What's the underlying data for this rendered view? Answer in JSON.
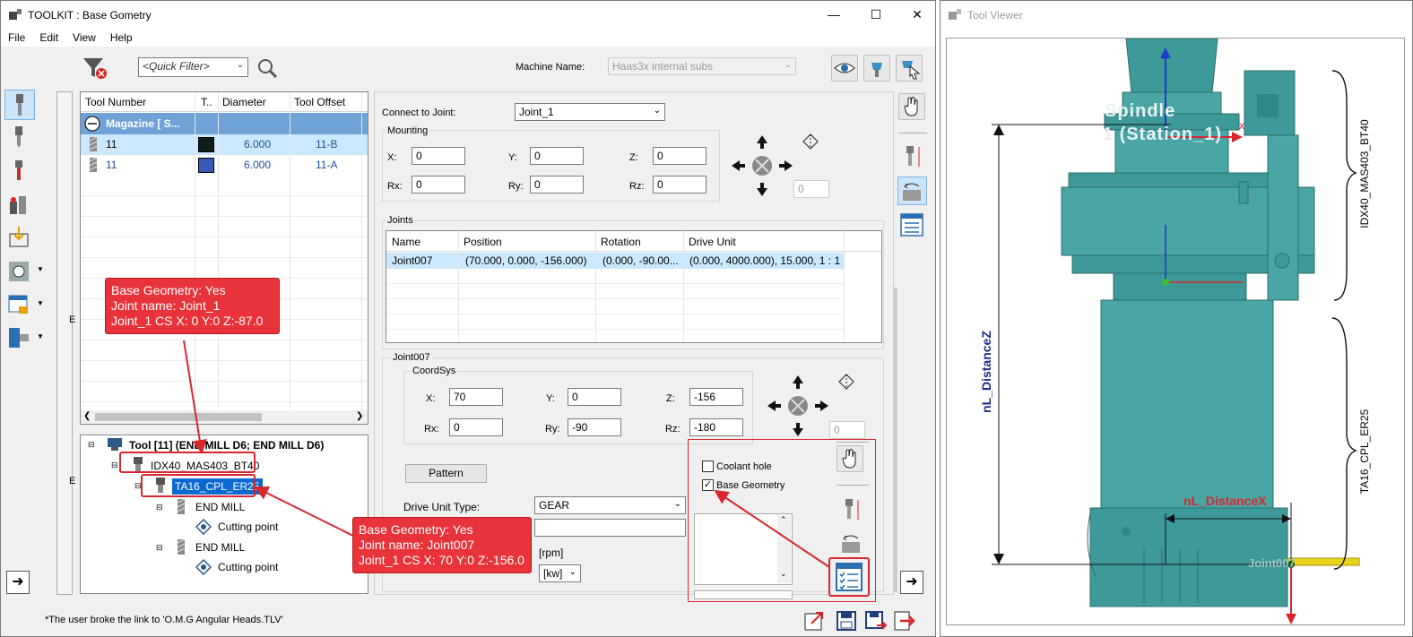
{
  "toolkit": {
    "title": "TOOLKIT : Base Gometry",
    "menu": [
      "File",
      "Edit",
      "View",
      "Help"
    ],
    "quick_filter": "<Quick Filter>",
    "machine_label": "Machine Name:",
    "machine_value": "Haas3x internal subs",
    "status": "*The user broke the link to 'O.M.G Angular Heads.TLV'"
  },
  "tool_table": {
    "headers": [
      "Tool Number",
      "T..",
      "Diameter",
      "Tool Offset"
    ],
    "magazine": "Magazine [ S...",
    "rows": [
      {
        "number": "11",
        "color": "#0b1f1a",
        "diameter": "6.000",
        "offset": "11-B"
      },
      {
        "number": "11",
        "color": "#3a58b8",
        "diameter": "6.000",
        "offset": "11-A"
      }
    ]
  },
  "tree": {
    "root": "Tool [11] (END MILL D6; END MILL D6)",
    "holder1": "IDX40_MAS403_BT40",
    "holder2": "TA16_CPL_ER25",
    "end_mill_1": "END MILL",
    "cutting_point_1": "Cutting point",
    "end_mill_2": "END MILL",
    "cutting_point_2": "Cutting point"
  },
  "joint_panel": {
    "connect_label": "Connect to Joint:",
    "connect_value": "Joint_1",
    "mounting": {
      "title": "Mounting",
      "x_label": "X:",
      "x": "0",
      "y_label": "Y:",
      "y": "0",
      "z_label": "Z:",
      "z": "0",
      "rx_label": "Rx:",
      "rx": "0",
      "ry_label": "Ry:",
      "ry": "0",
      "rz_label": "Rz:",
      "rz": "0",
      "step": "0"
    },
    "joints": {
      "title": "Joints",
      "headers": [
        "Name",
        "Position",
        "Rotation",
        "Drive Unit"
      ],
      "row": {
        "name": "Joint007",
        "position": "(70.000, 0.000, -156.000)",
        "rotation": "(0.000, -90.00...",
        "drive": "(0.000, 4000.000), 15.000, 1 : 1"
      }
    },
    "joint007": {
      "title": "Joint007",
      "coordsys": "CoordSys",
      "x_label": "X:",
      "x": "70",
      "y_label": "Y:",
      "y": "0",
      "z_label": "Z:",
      "z": "-156",
      "rx_label": "Rx:",
      "rx": "0",
      "ry_label": "Ry:",
      "ry": "-90",
      "rz_label": "Rz:",
      "rz": "-180",
      "step": "0",
      "pattern": "Pattern",
      "drive_unit_label": "Drive Unit Type:",
      "drive_unit_value": "GEAR",
      "rpm": "[rpm]",
      "kw": "[kw]",
      "coolant_hole": "Coolant hole",
      "base_geometry": "Base Geometry"
    }
  },
  "callouts": {
    "c1": [
      "Base Geometry: Yes",
      "Joint name: Joint_1",
      "Joint_1 CS X: 0 Y:0 Z:-87.0"
    ],
    "c2": [
      "Base Geometry: Yes",
      "Joint name: Joint007",
      "Joint_1 CS X: 70 Y:0 Z:-156.0"
    ]
  },
  "viewer": {
    "title": "Tool Viewer",
    "spindle_label_1": "Spindle",
    "spindle_label_2": "1 (Station_1)",
    "axis_z": "z",
    "axis_x": "x",
    "dim_z": "nL_DistanceZ",
    "dim_x": "nL_DistanceX",
    "holder_upper": "IDX40_MAS403_BT40",
    "holder_lower": "TA16_CPL_ER25",
    "joint_label": "Joint007"
  },
  "colors": {
    "accent": "#e8333a",
    "selection": "#cce8ff",
    "tool_body": "#3d9a98",
    "dim_blue": "#1f2a8c"
  }
}
